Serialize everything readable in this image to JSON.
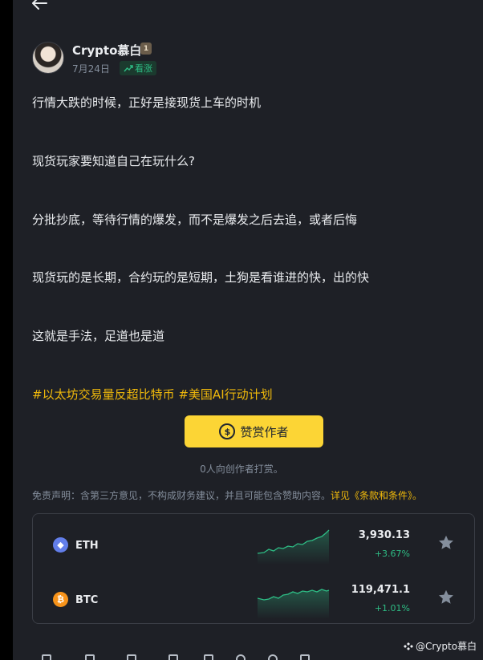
{
  "header": {
    "back_icon": "arrow-left-icon"
  },
  "author": {
    "name": "Crypto慕白",
    "badge": "1",
    "date": "7月24日",
    "sentiment": "看涨"
  },
  "post": {
    "paragraphs": [
      "行情大跌的时候，正好是接现货上车的时机",
      "现货玩家要知道自己在玩什么?",
      " 分批抄底，等待行情的爆发，而不是爆发之后去追，或者后悔",
      "现货玩的是长期，合约玩的是短期，土狗是看谁进的快，出的快",
      "这就是手法，足道也是道"
    ],
    "hashtags": [
      "#以太坊交易量反超比特币",
      "#美国AI行动计划"
    ]
  },
  "tip": {
    "button_label": "赞赏作者",
    "coin_glyph": "$",
    "count_text": "0人向创作者打赏。"
  },
  "disclaimer": {
    "text": "免责声明：含第三方意见，不构成财务建议，并且可能包含赞助内容。",
    "link": "详见《条款和条件》。"
  },
  "market": {
    "rows": [
      {
        "symbol": "ETH",
        "price": "3,930.13",
        "change": "+3.67%",
        "logo_color": "#627eea",
        "logo_glyph": "◆"
      },
      {
        "symbol": "BTC",
        "price": "119,471.1",
        "change": "+1.01%",
        "logo_color": "#f7931a",
        "logo_glyph": "₿"
      }
    ]
  },
  "watermark": "@Crypto慕白",
  "colors": {
    "accent": "#fcd535",
    "up": "#2ebd85",
    "bg": "#1e2026",
    "muted": "#848e9c"
  }
}
